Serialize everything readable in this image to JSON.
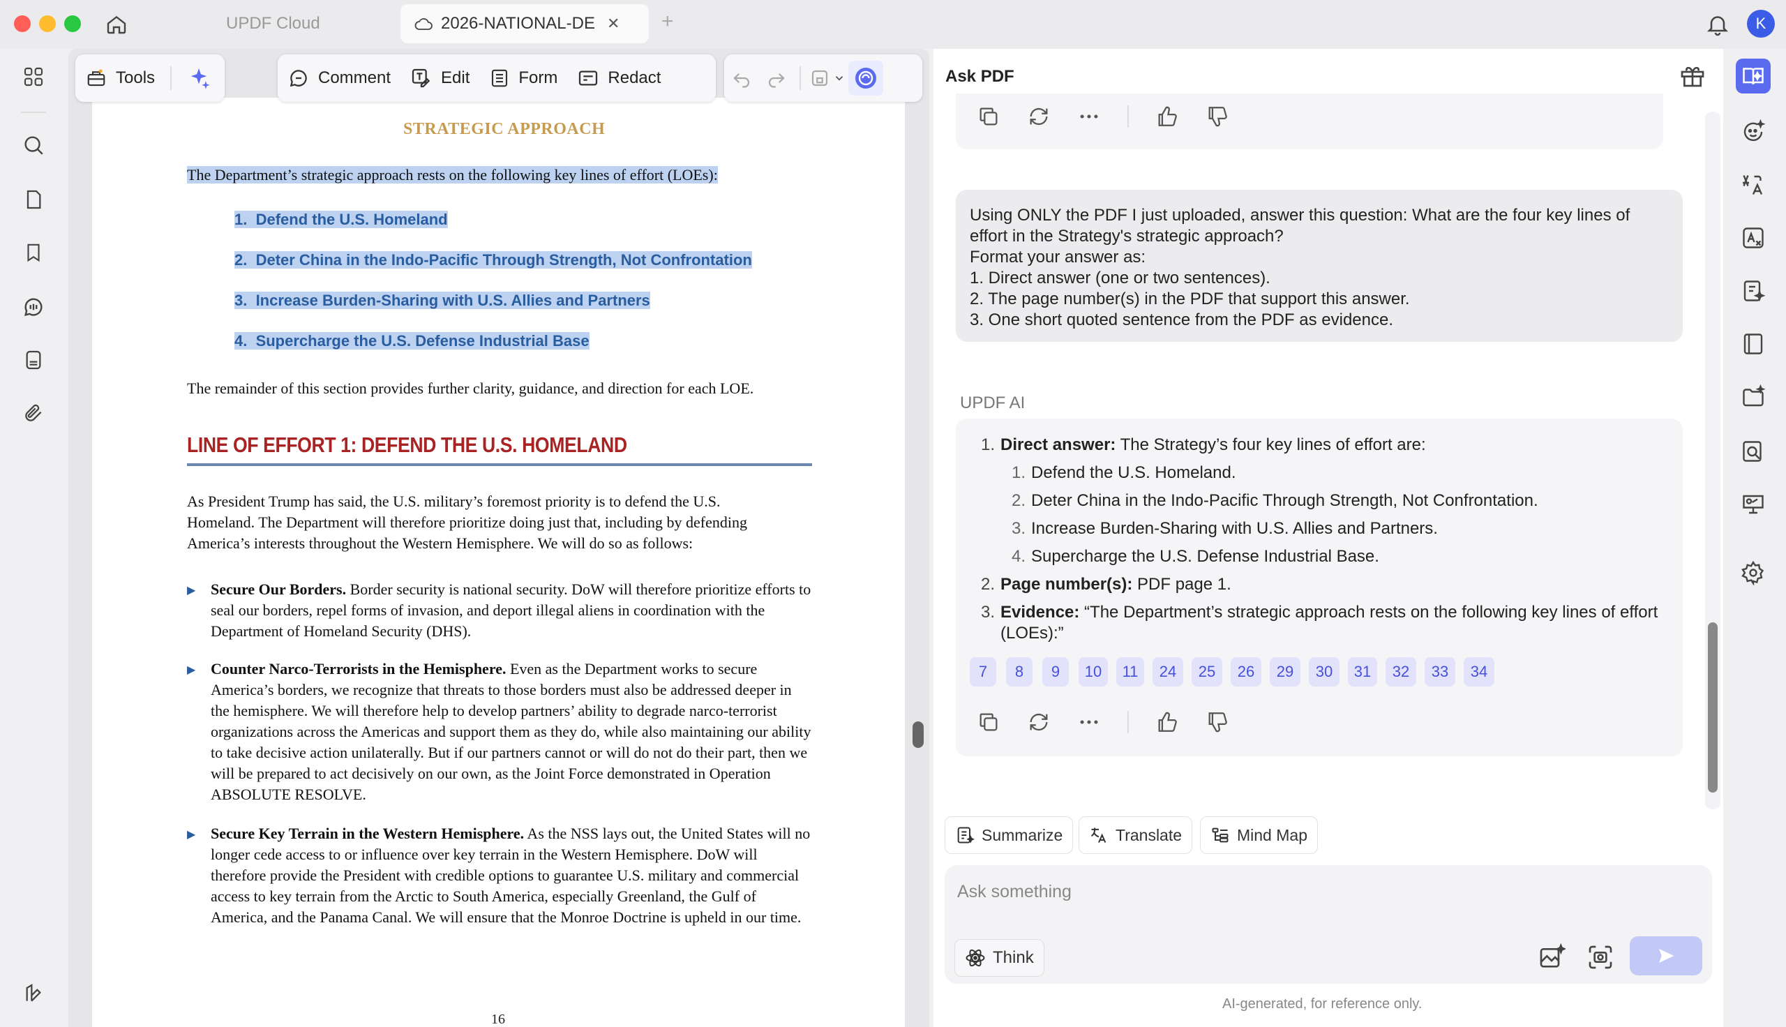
{
  "window": {
    "tabs": [
      {
        "label": "UPDF Cloud"
      },
      {
        "label": "2026-NATIONAL-DE"
      }
    ],
    "avatar_initial": "K"
  },
  "toolbar": {
    "tools_label": "Tools",
    "comment_label": "Comment",
    "edit_label": "Edit",
    "form_label": "Form",
    "redact_label": "Redact"
  },
  "document": {
    "section_title": "STRATEGIC APPROACH",
    "intro": "The Department’s strategic approach rests on the following key lines of effort (LOEs):",
    "loes": [
      "1.  Defend the U.S. Homeland",
      "2.  Deter China in the Indo-Pacific Through Strength, Not Confrontation",
      "3.  Increase Burden-Sharing with U.S. Allies and Partners",
      "4.  Supercharge the U.S. Defense Industrial Base"
    ],
    "remainder": "The remainder of this section provides further clarity, guidance, and direction for each LOE.",
    "loe1_heading": "LINE OF EFFORT 1: DEFEND THE U.S. HOMELAND",
    "loe1_para": "As President Trump has said, the U.S. military’s foremost priority is to defend the U.S. Homeland. The Department will therefore prioritize doing just that, including by defending America’s interests throughout the Western Hemisphere. We will do so as follows:",
    "bullets": [
      {
        "lead": "Secure Our Borders.",
        "text": " Border security is national security. DoW will therefore prioritize efforts to seal our borders, repel forms of invasion, and deport illegal aliens in coordination with the Department of Homeland Security (DHS)."
      },
      {
        "lead": "Counter Narco-Terrorists in the Hemisphere.",
        "text": " Even as the Department works to secure America’s borders, we recognize that threats to those borders must also be addressed deeper in the hemisphere. We will therefore help to develop partners’ ability to degrade narco-terrorist organizations across the Americas and support them as they do, while also maintaining our ability to take decisive action unilaterally. But if our partners cannot or will do not do their part, then we will be prepared to act decisively on our own, as the Joint Force demonstrated in Operation ABSOLUTE RESOLVE."
      },
      {
        "lead": "Secure Key Terrain in the Western Hemisphere.",
        "text": " As the NSS lays out, the United States will no longer cede access to or influence over key terrain in the Western Hemisphere. DoW will therefore provide the President with credible options to guarantee U.S. military and commercial access to key terrain from the Arctic to South America, especially Greenland, the Gulf of America, and the Panama Canal. We will ensure that the Monroe Doctrine is upheld in our time."
      }
    ],
    "page_number": "16"
  },
  "ask_panel": {
    "title": "Ask PDF",
    "user_message": "Using ONLY the PDF I just uploaded, answer this question: What are the four key lines of effort in the Strategy's strategic approach?\nFormat your answer as:\n1. Direct answer (one or two sentences).\n2. The page number(s) in the PDF that support this answer.\n3. One short quoted sentence from the PDF as evidence.",
    "ai_label": "UPDF AI",
    "answer": {
      "direct_label": "Direct answer:",
      "direct_text": " The Strategy’s four key lines of effort are:",
      "sub_items": [
        "Defend the U.S. Homeland.",
        "Deter China in the Indo-Pacific Through Strength, Not Confrontation.",
        "Increase Burden-Sharing with U.S. Allies and Partners.",
        "Supercharge the U.S. Defense Industrial Base."
      ],
      "pages_label": "Page number(s):",
      "pages_text": " PDF page 1.",
      "evidence_label": "Evidence:",
      "evidence_text": " “The Department’s strategic approach rests on the following key lines of effort (LOEs):”"
    },
    "page_chips": [
      "7",
      "8",
      "9",
      "10",
      "11",
      "24",
      "25",
      "26",
      "29",
      "30",
      "31",
      "32",
      "33",
      "34"
    ],
    "quick_actions": [
      "Summarize",
      "Translate",
      "Mind Map"
    ],
    "input_placeholder": "Ask something",
    "think_label": "Think",
    "disclaimer": "AI-generated, for reference only."
  },
  "colors": {
    "accent": "#5b6bf0",
    "chip_bg": "#e2e3fb",
    "highlight": "#bcd2f0",
    "loe_blue": "#2a5d9f",
    "heading_red": "#a82323",
    "section_gold": "#c69a4f"
  }
}
